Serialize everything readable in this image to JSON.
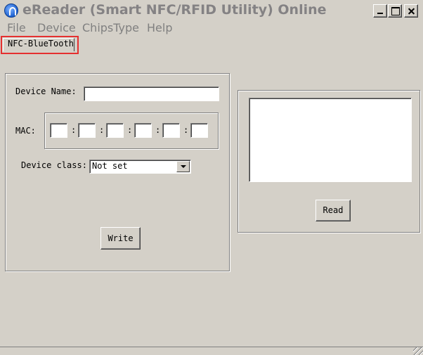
{
  "window": {
    "title": "eReader (Smart NFC/RFID Utility) Online"
  },
  "menu": {
    "file": "File",
    "device": "Device",
    "chipstype": "ChipsType",
    "help": "Help"
  },
  "tabs": [
    {
      "label": "NFC-BlueTooth",
      "selected": true
    }
  ],
  "form": {
    "device_name_label": "Device Name:",
    "device_name_value": "",
    "mac_label": "MAC:",
    "mac_separator": ":",
    "mac_values": [
      "",
      "",
      "",
      "",
      "",
      ""
    ],
    "device_class_label": "Device class:",
    "device_class_value": "Not set",
    "write_label": "Write"
  },
  "output": {
    "text": "",
    "read_label": "Read"
  },
  "icons": {
    "app": "app-logo-icon",
    "minimize": "minimize-icon",
    "maximize": "maximize-icon",
    "close": "close-icon",
    "dropdown": "chevron-down-icon"
  },
  "colors": {
    "window_bg": "#d4d0c8",
    "title_text": "#848284",
    "tab_highlight": "#e53030"
  }
}
